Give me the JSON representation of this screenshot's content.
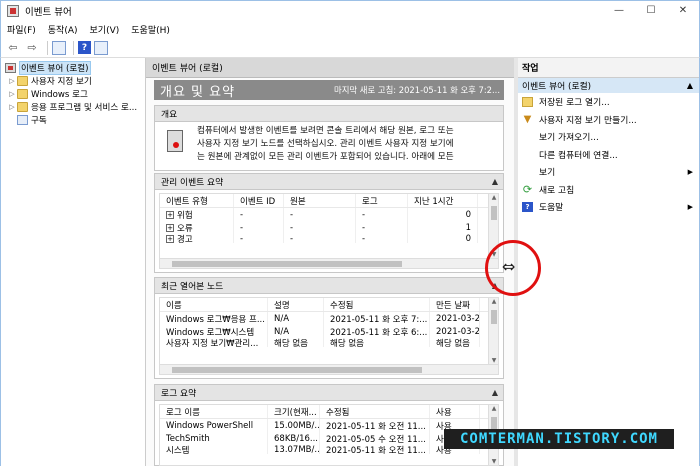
{
  "window": {
    "title": "이벤트 뷰어",
    "controls": [
      "—",
      "☐",
      "✕"
    ]
  },
  "menu": [
    "파일(F)",
    "동작(A)",
    "보기(V)",
    "도움말(H)"
  ],
  "tree": {
    "root": "이벤트 뷰어 (로컬)",
    "items": [
      "사용자 지정 보기",
      "Windows 로그",
      "응용 프로그램 및 서비스 로...",
      "구독"
    ]
  },
  "center": {
    "header": "이벤트 뷰어 (로컬)",
    "summary_title": "개요 및 요약",
    "last_refresh": "마지막 새로 고침: 2021-05-11 화 오후 7:2...",
    "overview": {
      "heading": "개요",
      "lines": [
        "컴퓨터에서 발생한 이벤트를 보려면 콘솔 트리에서 해당 원본, 로그 또는",
        "사용자 지정 보기 노드를 선택하십시오. 관리 이벤트 사용자 지정 보기에",
        "는 원본에 관계없이 모든 관리 이벤트가 포함되어 있습니다. 아래에 모든"
      ]
    },
    "admin_summary": {
      "heading": "관리 이벤트 요약",
      "columns": [
        "이벤트 유형",
        "이벤트 ID",
        "원본",
        "로그",
        "지난 1시간"
      ],
      "rows": [
        [
          "위험",
          "-",
          "-",
          "-",
          "0"
        ],
        [
          "오류",
          "-",
          "-",
          "-",
          "1"
        ],
        [
          "경고",
          "-",
          "-",
          "-",
          "0"
        ]
      ]
    },
    "recent_nodes": {
      "heading": "최근 열어본 노드",
      "columns": [
        "이름",
        "설명",
        "수정됨",
        "만든 날짜"
      ],
      "rows": [
        [
          "Windows 로그₩응용 프...",
          "N/A",
          "2021-05-11 화 오후 7:...",
          "2021-03-2..."
        ],
        [
          "Windows 로그₩시스템",
          "N/A",
          "2021-05-11 화 오후 6:...",
          "2021-03-2..."
        ],
        [
          "사용자 지정 보기₩관리...",
          "해당 없음",
          "해당 없음",
          "해당 없음"
        ]
      ]
    },
    "log_summary": {
      "heading": "로그 요약",
      "columns": [
        "로그 이름",
        "크기(현재...",
        "수정됨",
        "사용"
      ],
      "rows": [
        [
          "Windows PowerShell",
          "15.00MB/...",
          "2021-05-11 화 오전 11...",
          "사용"
        ],
        [
          "TechSmith",
          "68KB/16...",
          "2021-05-05 수 오전 11...",
          "사용"
        ],
        [
          "시스템",
          "13.07MB/...",
          "2021-05-11 화 오전 11...",
          "사용"
        ]
      ]
    }
  },
  "actions": {
    "title": "작업",
    "group": "이벤트 뷰어 (로컬)",
    "items": [
      "저장된 로그 열기...",
      "사용자 지정 보기 만들기...",
      "보기 가져오기...",
      "다른 컴퓨터에 연결...",
      "보기",
      "새로 고침",
      "도움말"
    ]
  },
  "overlay": {
    "cursor_glyph": "⇔",
    "watermark": "COMTERMAN.TISTORY.COM",
    "circle_color": "#e01010"
  }
}
